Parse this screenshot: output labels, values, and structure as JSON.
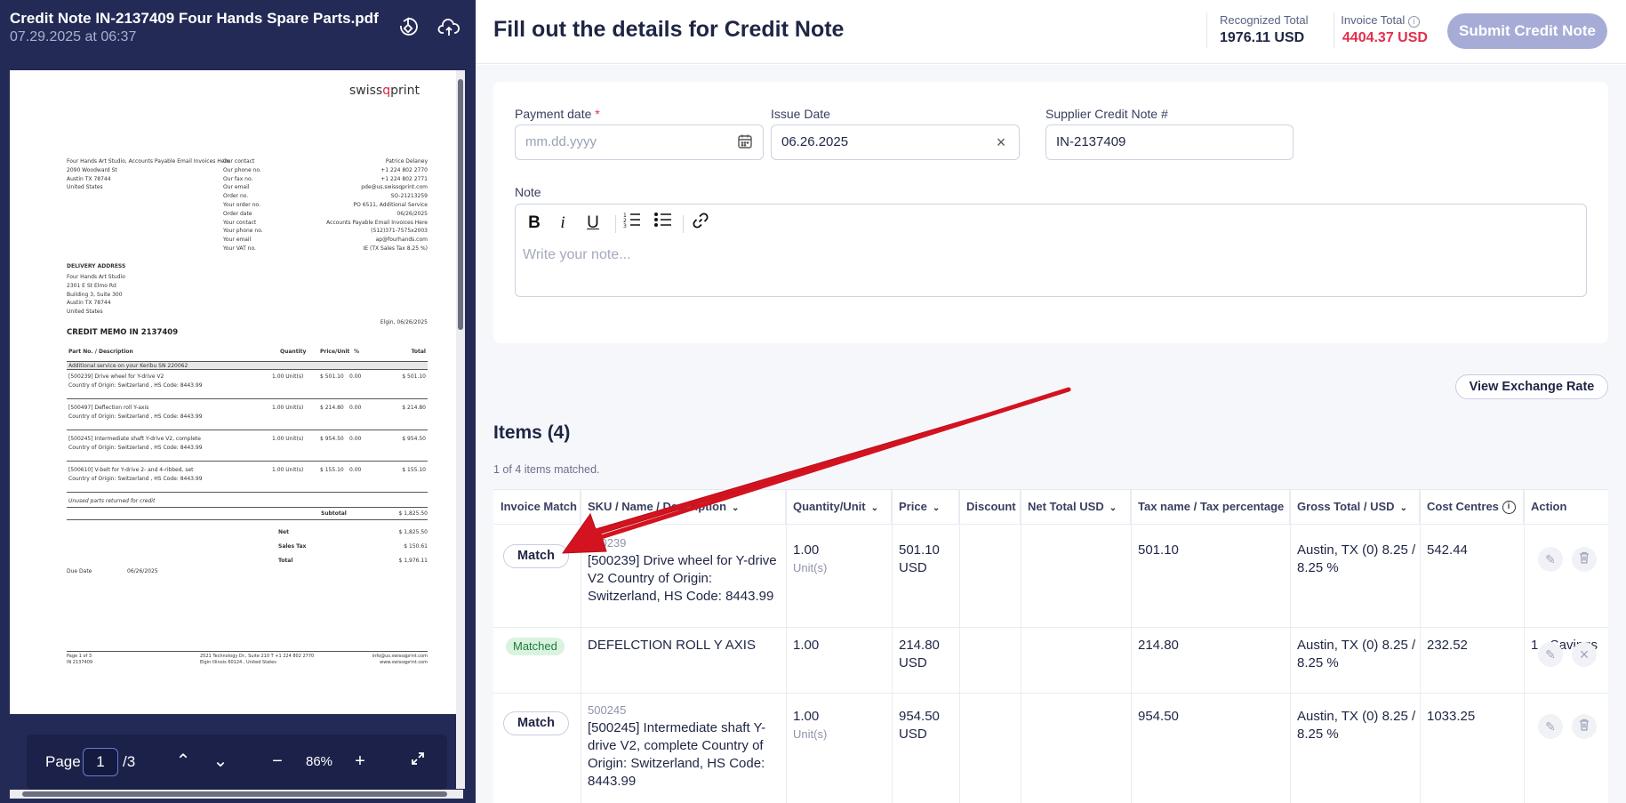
{
  "document": {
    "title": "Credit Note IN-2137409 Four Hands Spare Parts.pdf",
    "timestamp": "07.29.2025 at 06:37",
    "icons": [
      "rotate-icon",
      "cloud-upload-icon"
    ]
  },
  "pdf": {
    "brand_prefix": "swiss",
    "brand_accent": "q",
    "brand_suffix": "print",
    "bill_to": [
      "Four Hands Art Studio, Accounts Payable Email Invoices Here",
      "2090 Woodward St",
      "Austin TX 78744",
      "United States"
    ],
    "contact_labels": [
      "Our contact",
      "Our phone no.",
      "Our fax no.",
      "Our email",
      "Order no.",
      "Your order no.",
      "Order date",
      "Your contact",
      "Your phone no.",
      "Your email",
      "Your VAT no."
    ],
    "contact_values": [
      "Patrice Delaney",
      "+1 224 802 2770",
      "+1 224 802 2771",
      "pde@us.swissqprint.com",
      "SO-21213259",
      "PO 6511, Additional Service",
      "06/26/2025",
      "Accounts Payable Email Invoices Here",
      "(512)371-7575x2003",
      "ap@fourhands.com",
      "IE (TX Sales Tax 8.25 %)"
    ],
    "delivery_heading": "DELIVERY ADDRESS",
    "delivery": [
      "Four Hands Art Studio",
      "2301 E St Elmo Rd",
      "Building 3, Suite 300",
      "Austin TX 78744",
      "United States"
    ],
    "place_date": "Elgin, 06/26/2025",
    "memo_title": "CREDIT MEMO IN 2137409",
    "table_head": [
      "Part No. / Description",
      "Quantity",
      "Price/Unit",
      "%",
      "Total"
    ],
    "group_label": "Additional service on your Keribu SN 220062",
    "rows": [
      {
        "desc": "[500239] Drive wheel for Y-drive V2",
        "origin": "Country of Origin: Switzerland , HS Code: 8443.99",
        "qty": "1.00 Unit(s)",
        "price": "$ 501.10",
        "pct": "0.00",
        "total": "$ 501.10"
      },
      {
        "desc": "[500497] Deflection roll Y-axis",
        "origin": "Country of Origin: Switzerland , HS Code: 8443.99",
        "qty": "1.00 Unit(s)",
        "price": "$ 214.80",
        "pct": "0.00",
        "total": "$ 214.80"
      },
      {
        "desc": "[500245] Intermediate shaft Y-drive V2, complete",
        "origin": "Country of Origin: Switzerland , HS Code: 8443.99",
        "qty": "1.00 Unit(s)",
        "price": "$ 954.50",
        "pct": "0.00",
        "total": "$ 954.50"
      },
      {
        "desc": "[500610] V-belt for Y-drive 2- and 4-ribbed, set",
        "origin": "Country of Origin: Switzerland , HS Code: 8443.99",
        "qty": "1.00 Unit(s)",
        "price": "$ 155.10",
        "pct": "0.00",
        "total": "$ 155.10"
      }
    ],
    "note_line": "Unused parts returned for credit",
    "subtotal_label": "Subtotal",
    "subtotal": "$ 1,825.50",
    "net_label": "Net",
    "net": "$ 1,825.50",
    "tax_label": "Sales Tax",
    "tax": "$ 150.61",
    "total_label": "Total",
    "total": "$ 1,976.11",
    "due_label": "Due Date",
    "due": "06/26/2025",
    "footer_left": [
      "Page 1 of 3",
      "IN 2137409"
    ],
    "footer_mid": [
      "2521 Technology Dr., Suite 210     T +1 224 802 2770",
      "Elgin Illinois 60124 , United States"
    ],
    "footer_right": [
      "info@us.swissqprint.com",
      "www.swissqprint.com"
    ]
  },
  "pager": {
    "label": "Page",
    "current": "1",
    "total": "/3",
    "zoom": "86%",
    "icons": [
      "chevron-up-icon",
      "chevron-down-icon",
      "zoom-out-icon",
      "zoom-in-icon",
      "expand-icon"
    ]
  },
  "header": {
    "title": "Fill out the details for Credit Note",
    "recognized_label": "Recognized Total",
    "recognized_value": "1976.11 USD",
    "invoice_label": "Invoice Total",
    "invoice_value": "4404.37 USD",
    "submit_label": "Submit Credit Note",
    "invoice_color": "#e0304e"
  },
  "form": {
    "payment_label": "Payment date",
    "payment_required": "*",
    "payment_placeholder": "mm.dd.yyyy",
    "issue_label": "Issue Date",
    "issue_value": "06.26.2025",
    "supplier_label": "Supplier Credit Note #",
    "supplier_value": "IN-2137409",
    "note_label": "Note",
    "note_placeholder": "Write your note..."
  },
  "toolbar": {
    "bold": "B",
    "italic": "i",
    "underline": "U"
  },
  "exchange_label": "View Exchange Rate",
  "items": {
    "title": "Items (4)",
    "subtitle": "1 of 4 items matched.",
    "columns": [
      "Invoice Match",
      "SKU / Name / Description",
      "Quantity/Unit",
      "Price",
      "Discount",
      "Net Total USD",
      "Tax name / Tax percentage",
      "Gross Total / USD",
      "Cost Centres",
      "Action"
    ],
    "rows": [
      {
        "match": "Match",
        "sku": "500239",
        "name": "[500239] Drive wheel for Y-drive V2 Country of Origin: Switzerland, HS Code: 8443.99",
        "qty": "1.00",
        "unit": "Unit(s)",
        "price": "501.10 USD",
        "net": "501.10",
        "tax": "Austin, TX (0) 8.25 / 8.25 %",
        "gross": "542.44",
        "cost": ""
      },
      {
        "match": "Matched",
        "sku": "",
        "name": "DEFELCTION ROLL Y AXIS",
        "qty": "1.00",
        "unit": "",
        "price": "214.80 USD",
        "net": "214.80",
        "tax": "Austin, TX (0) 8.25 / 8.25 %",
        "gross": "232.52",
        "cost": "1 - Savings"
      },
      {
        "match": "Match",
        "sku": "500245",
        "name": "[500245] Intermediate shaft Y-drive V2, complete Country of Origin: Switzerland, HS Code: 8443.99",
        "qty": "1.00",
        "unit": "Unit(s)",
        "price": "954.50 USD",
        "net": "954.50",
        "tax": "Austin, TX (0) 8.25 / 8.25 %",
        "gross": "1033.25",
        "cost": ""
      }
    ]
  },
  "annotation": {
    "type": "arrow",
    "color": "#d3131f"
  }
}
